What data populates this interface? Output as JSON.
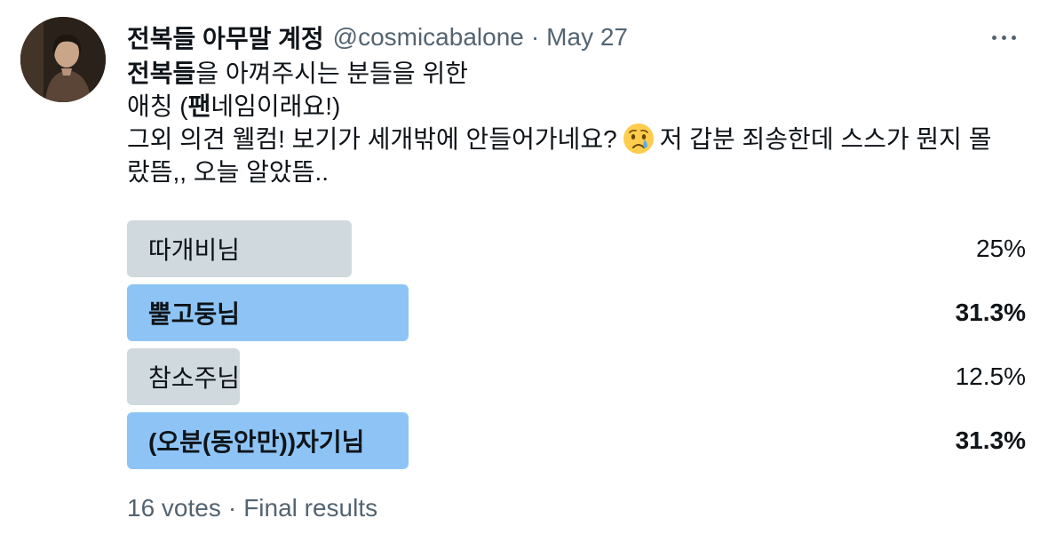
{
  "author": {
    "display_name": "전복들 아무말 계정",
    "handle": "@cosmicabalone",
    "separator": "·",
    "date": "May 27",
    "avatar_icon": "profile-photo"
  },
  "menu": {
    "icon": "more-horizontal-icon"
  },
  "tweet": {
    "line1_bold": "전복들",
    "line1_rest": "을 아껴주시는 분들을 위한",
    "line2_pre": "애칭 (",
    "line2_bold": "팬",
    "line2_rest": "네임이래요!)",
    "line3_pre": "그외 의견 웰컴! 보기가 세개밖에 안들어가네요?",
    "line3_emoji": "crying-face-emoji",
    "line3_post": "저 갑분 죄송한데 스스가 뭔지 몰",
    "line4": "랐뜸,, 오늘 알았뜸.."
  },
  "poll": {
    "options": [
      {
        "label": "따개비님",
        "percent_text": "25%",
        "percent": 25,
        "winner": false
      },
      {
        "label": "뿔고둥님",
        "percent_text": "31.3%",
        "percent": 31.3,
        "winner": true
      },
      {
        "label": "참소주님",
        "percent_text": "12.5%",
        "percent": 12.5,
        "winner": false
      },
      {
        "label": "(오분(동안만))자기님",
        "percent_text": "31.3%",
        "percent": 31.3,
        "winner": true
      }
    ],
    "votes": "16 votes",
    "separator": "·",
    "status": "Final results"
  },
  "colors": {
    "bar_winner": "#8ec4f5",
    "bar_other": "#cfd9de",
    "secondary_text": "#536471",
    "primary_text": "#0f1419"
  }
}
